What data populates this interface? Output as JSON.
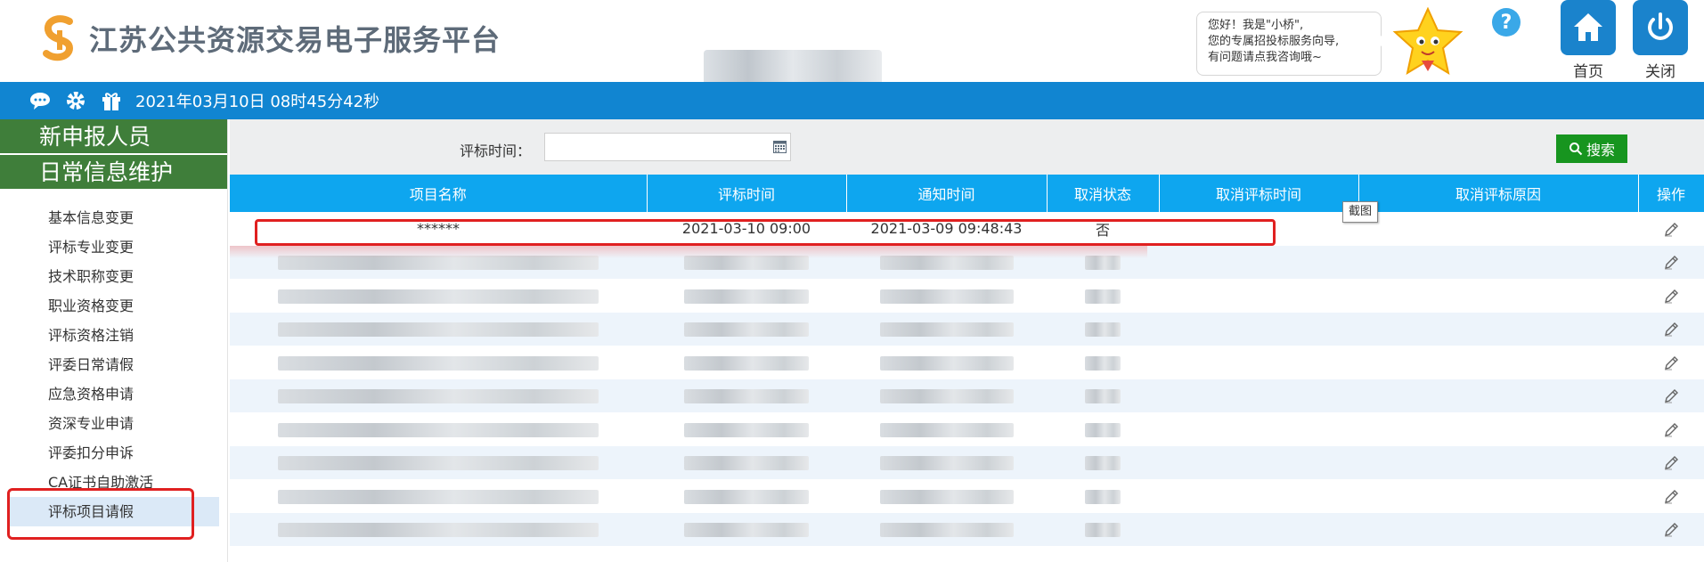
{
  "header": {
    "title": "江苏公共资源交易电子服务平台",
    "bubble_lines": [
      "您好！我是\"小桥\",",
      "您的专属招投标服务向导,",
      "有问题请点我咨询哦~"
    ],
    "home_label": "首页",
    "close_label": "关闭",
    "icons": [
      "logo-mark",
      "mascot",
      "help-icon",
      "home-icon",
      "power-icon"
    ]
  },
  "bar": {
    "datetime": "2021年03月10日 08时45分42秒",
    "icons": [
      "chat-icon",
      "gear-icon",
      "gift-icon"
    ]
  },
  "sidebar": {
    "headers": [
      "新申报人员",
      "日常信息维护"
    ],
    "items": [
      {
        "label": "基本信息变更"
      },
      {
        "label": "评标专业变更"
      },
      {
        "label": "技术职称变更"
      },
      {
        "label": "职业资格变更"
      },
      {
        "label": "评标资格注销"
      },
      {
        "label": "评委日常请假"
      },
      {
        "label": "应急资格申请"
      },
      {
        "label": "资深专业申请"
      },
      {
        "label": "评委扣分申诉"
      },
      {
        "label": "CA证书自助激活"
      },
      {
        "label": "评标项目请假",
        "active": true
      }
    ]
  },
  "search": {
    "label": "评标时间：",
    "value": "",
    "button": "搜索"
  },
  "table": {
    "columns": [
      "项目名称",
      "评标时间",
      "通知时间",
      "取消状态",
      "取消评标时间",
      "取消评标原因",
      "操作"
    ],
    "first_row": {
      "name": "******",
      "eval_time": "2021-03-10 09:00",
      "notice_time": "2021-03-09 09:48:43",
      "cancel_status": "否",
      "cancel_time": "",
      "cancel_reason": ""
    },
    "blurred_row_count": 9
  },
  "tooltip": "截图",
  "colors": {
    "brand_blue": "#1185d1",
    "sidebar_green": "#3f7e3a",
    "table_header": "#0ea6ef",
    "search_green": "#17951f",
    "highlight_red": "#e02020"
  }
}
